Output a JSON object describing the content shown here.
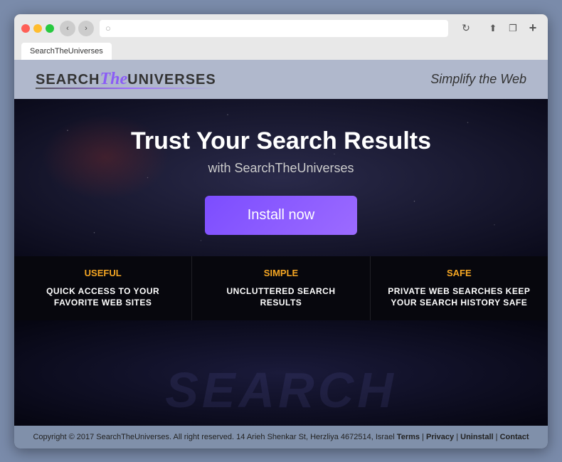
{
  "browser": {
    "tab_label": "SearchTheUniverses",
    "address": "",
    "reload_title": "Reload"
  },
  "header": {
    "logo_search": "SEARCH",
    "logo_the": "The",
    "logo_universes": "UNIVERSES",
    "tagline": "Simplify the Web"
  },
  "hero": {
    "title": "Trust Your Search Results",
    "subtitle": "with SearchTheUniverses",
    "install_button": "Install now"
  },
  "features": [
    {
      "label": "USEFUL",
      "label_color": "#f5a623",
      "description": "QUICK ACCESS TO YOUR FAVORITE WEB SITES"
    },
    {
      "label": "SIMPLE",
      "label_color": "#f5a623",
      "description": "UNCLUTTERED SEARCH RESULTS"
    },
    {
      "label": "SAFE",
      "label_color": "#f5a623",
      "description": "PRIVATE WEB SEARCHES KEEP YOUR SEARCH HISTORY SAFE"
    }
  ],
  "watermark": {
    "text": "SEARCH"
  },
  "footer": {
    "text": "Copyright © 2017 SearchTheUniverses. All right reserved. 14 Arieh Shenkar St, Herzliya 4672514, Israel",
    "links": [
      "Terms",
      "Privacy",
      "Uninstall",
      "Contact"
    ]
  }
}
